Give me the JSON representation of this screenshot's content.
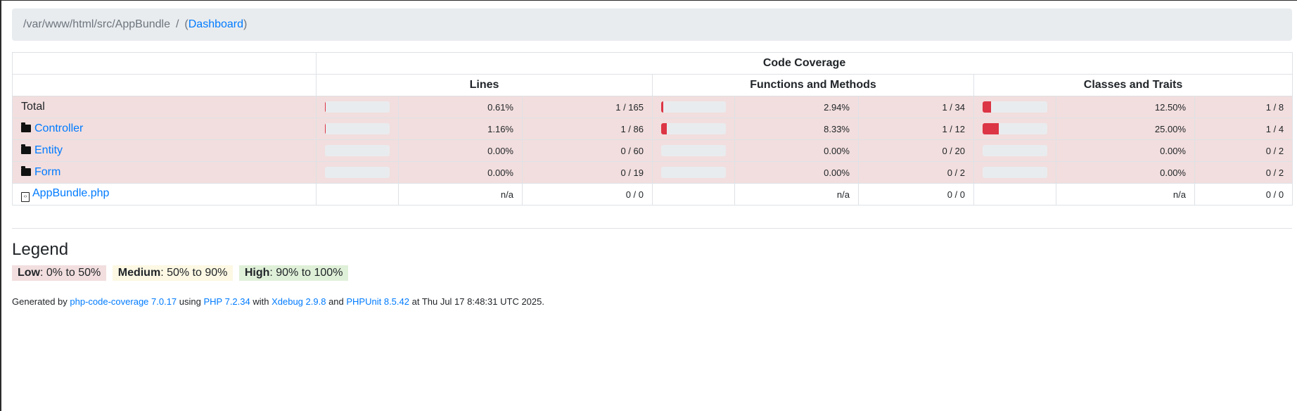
{
  "breadcrumb": {
    "path": "/var/www/html/src/AppBundle",
    "separator": "/",
    "open_paren": "(",
    "dashboard_link": "Dashboard",
    "close_paren": ")"
  },
  "table": {
    "group_header": "Code Coverage",
    "columns": [
      "Lines",
      "Functions and Methods",
      "Classes and Traits"
    ],
    "rows": [
      {
        "name": "Total",
        "kind": "total",
        "lines": {
          "pct": "0.61%",
          "ratio": "1 / 165",
          "fill": 0.0061
        },
        "functions": {
          "pct": "2.94%",
          "ratio": "1 / 34",
          "fill": 0.0294
        },
        "classes": {
          "pct": "12.50%",
          "ratio": "1 / 8",
          "fill": 0.125
        }
      },
      {
        "name": "Controller",
        "kind": "folder",
        "lines": {
          "pct": "1.16%",
          "ratio": "1 / 86",
          "fill": 0.0116
        },
        "functions": {
          "pct": "8.33%",
          "ratio": "1 / 12",
          "fill": 0.0833
        },
        "classes": {
          "pct": "25.00%",
          "ratio": "1 / 4",
          "fill": 0.25
        }
      },
      {
        "name": "Entity",
        "kind": "folder",
        "lines": {
          "pct": "0.00%",
          "ratio": "0 / 60",
          "fill": 0
        },
        "functions": {
          "pct": "0.00%",
          "ratio": "0 / 20",
          "fill": 0
        },
        "classes": {
          "pct": "0.00%",
          "ratio": "0 / 2",
          "fill": 0
        }
      },
      {
        "name": "Form",
        "kind": "folder",
        "lines": {
          "pct": "0.00%",
          "ratio": "0 / 19",
          "fill": 0
        },
        "functions": {
          "pct": "0.00%",
          "ratio": "0 / 2",
          "fill": 0
        },
        "classes": {
          "pct": "0.00%",
          "ratio": "0 / 2",
          "fill": 0
        }
      },
      {
        "name": "AppBundle.php",
        "kind": "file",
        "lines": {
          "pct": "n/a",
          "ratio": "0 / 0"
        },
        "functions": {
          "pct": "n/a",
          "ratio": "0 / 0"
        },
        "classes": {
          "pct": "n/a",
          "ratio": "0 / 0"
        }
      }
    ]
  },
  "legend": {
    "title": "Legend",
    "low_label": "Low",
    "low_range": ": 0% to 50%",
    "medium_label": "Medium",
    "medium_range": ": 50% to 90%",
    "high_label": "High",
    "high_range": ": 90% to 100%"
  },
  "footer": {
    "generated_by": "Generated by ",
    "tool_link": "php-code-coverage 7.0.17",
    "using": " using ",
    "php_link": "PHP 7.2.34",
    "with": " with ",
    "xdebug_link": "Xdebug 2.9.8",
    "and": " and ",
    "phpunit_link": "PHPUnit 8.5.42",
    "at": " at Thu Jul 17 8:48:31 UTC 2025."
  },
  "colors": {
    "danger": "#dc3545",
    "low_bg": "#f2dede",
    "medium_bg": "#fcf8e3",
    "high_bg": "#dff0d8",
    "link": "#007bff"
  },
  "icons": {
    "folder": "folder-icon",
    "file": "file-code-icon"
  }
}
